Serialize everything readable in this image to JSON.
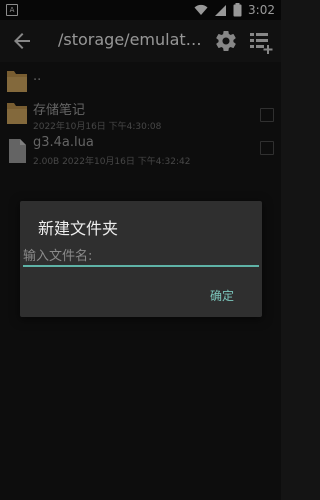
{
  "status_bar": {
    "left_badge": "A",
    "time": "3:02",
    "icons": [
      "wifi-icon",
      "signal-icon",
      "battery-icon"
    ]
  },
  "toolbar": {
    "path": "/storage/emulated...",
    "icons": [
      "back-arrow-icon",
      "gear-icon",
      "list-add-icon"
    ]
  },
  "files": [
    {
      "name": "..",
      "meta": "",
      "type": "folder"
    },
    {
      "name": "存储笔记",
      "meta": "2022年10月16日 下午4:30:08",
      "type": "folder"
    },
    {
      "name": "g3.4a.lua",
      "meta": "2.00B  2022年10月16日 下午4:32:42",
      "type": "file"
    }
  ],
  "dialog": {
    "title": "新建文件夹",
    "input_placeholder": "输入文件名:",
    "input_value": "",
    "confirm_label": "确定"
  },
  "colors": {
    "accent": "#5fb3a7",
    "folder": "#c9a25c",
    "background": "#141414"
  }
}
